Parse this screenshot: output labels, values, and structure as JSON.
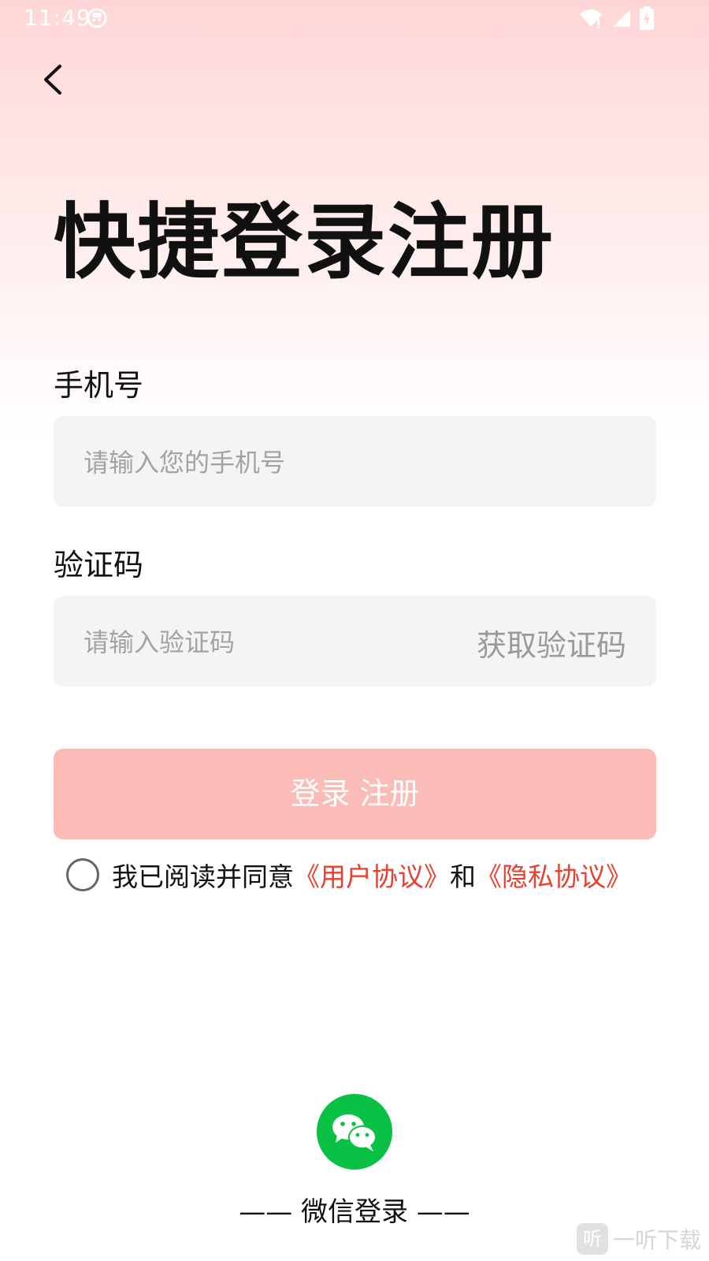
{
  "status_bar": {
    "time": "11:49",
    "icons": [
      "face-icon",
      "wifi-icon",
      "signal-icon",
      "battery-charging-icon"
    ]
  },
  "header": {
    "back_icon": "chevron-left-icon"
  },
  "title": "快捷登录注册",
  "phone": {
    "label": "手机号",
    "placeholder": "请输入您的手机号",
    "value": ""
  },
  "code": {
    "label": "验证码",
    "placeholder": "请输入验证码",
    "value": "",
    "get_code_label": "获取验证码"
  },
  "login_button": "登录 注册",
  "agreement": {
    "checked": false,
    "prefix": "我已阅读并同意",
    "user_agreement": "《用户协议》",
    "connector": "和",
    "privacy_agreement": "《隐私协议》"
  },
  "wechat": {
    "icon": "wechat-icon",
    "label": "—— 微信登录 ——"
  },
  "watermark": {
    "logo": "听",
    "text": "一听下载"
  },
  "colors": {
    "gradient_top": "#ffd6d6",
    "input_bg": "#f3f4f6",
    "login_button_bg": "#fbbcb8",
    "link_red": "#e8402f",
    "wechat_green": "#09c144"
  }
}
